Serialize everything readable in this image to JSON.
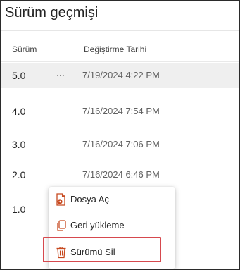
{
  "title": "Sürüm geçmişi",
  "columns": {
    "version": "Sürüm",
    "modified": "Değiştirme Tarihi"
  },
  "rows": [
    {
      "version": "5.0",
      "modified": "7/19/2024 4:22 PM",
      "more": "..."
    },
    {
      "version": "4.0",
      "modified": "7/16/2024 7:54 PM"
    },
    {
      "version": "3.0",
      "modified": "7/16/2024 7:06 PM"
    },
    {
      "version": "2.0",
      "modified": "7/16/2024 6:46 PM"
    },
    {
      "version": "1.0",
      "modified": ""
    }
  ],
  "menu": {
    "items": [
      {
        "label": "Dosya Aç",
        "icon": "document-open-icon"
      },
      {
        "label": "Geri yükleme",
        "icon": "restore-copy-icon"
      },
      {
        "label": "Sürümü Sil",
        "icon": "trash-icon"
      }
    ]
  },
  "colors": {
    "accent_orange": "#c7491f",
    "highlight_red": "#d6494e",
    "selected_row": "#efefef"
  }
}
